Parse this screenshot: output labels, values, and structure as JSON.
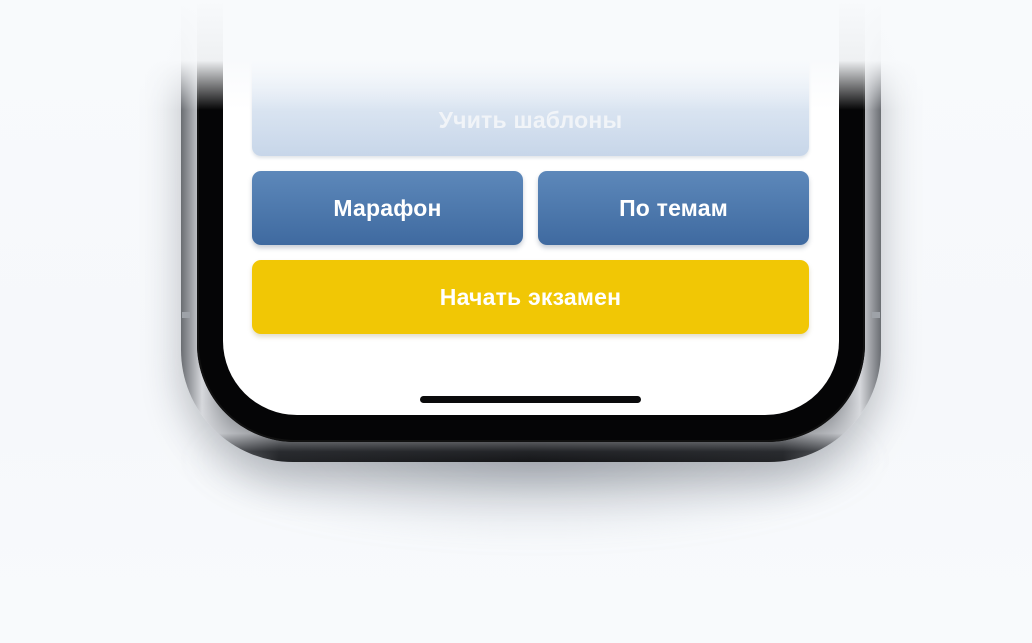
{
  "buttons": {
    "learn_templates": "Учить шаблоны",
    "marathon": "Марафон",
    "by_topics": "По темам",
    "start_exam": "Начать экзамен"
  },
  "colors": {
    "primary_blue": "#4a76ab",
    "exam_yellow": "#f1c705",
    "faded_button": "#c7d6e9",
    "background": "#f6f8fb"
  }
}
